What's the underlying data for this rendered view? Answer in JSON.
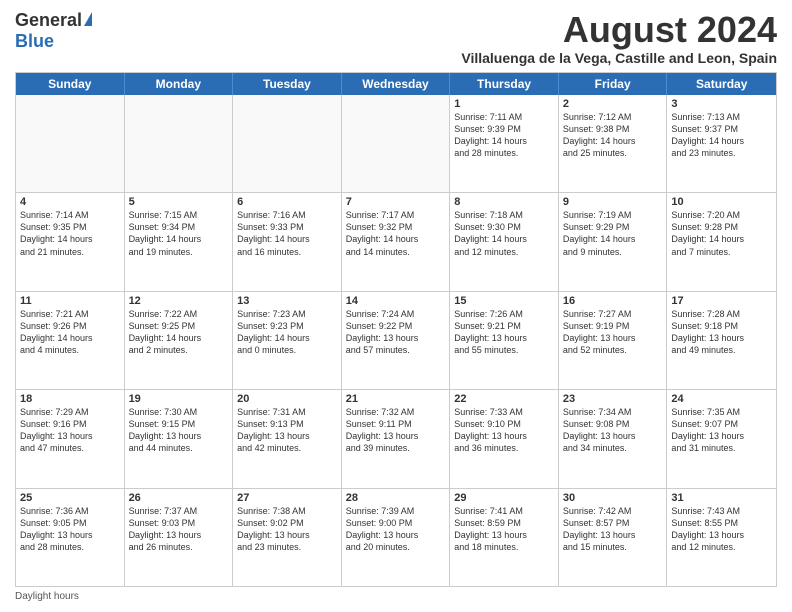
{
  "logo": {
    "general": "General",
    "blue": "Blue"
  },
  "header": {
    "month_title": "August 2024",
    "location": "Villaluenga de la Vega, Castille and Leon, Spain"
  },
  "weekdays": [
    "Sunday",
    "Monday",
    "Tuesday",
    "Wednesday",
    "Thursday",
    "Friday",
    "Saturday"
  ],
  "footer": {
    "label": "Daylight hours"
  },
  "rows": [
    [
      {
        "day": "",
        "info": "",
        "empty": true
      },
      {
        "day": "",
        "info": "",
        "empty": true
      },
      {
        "day": "",
        "info": "",
        "empty": true
      },
      {
        "day": "",
        "info": "",
        "empty": true
      },
      {
        "day": "1",
        "info": "Sunrise: 7:11 AM\nSunset: 9:39 PM\nDaylight: 14 hours\nand 28 minutes."
      },
      {
        "day": "2",
        "info": "Sunrise: 7:12 AM\nSunset: 9:38 PM\nDaylight: 14 hours\nand 25 minutes."
      },
      {
        "day": "3",
        "info": "Sunrise: 7:13 AM\nSunset: 9:37 PM\nDaylight: 14 hours\nand 23 minutes."
      }
    ],
    [
      {
        "day": "4",
        "info": "Sunrise: 7:14 AM\nSunset: 9:35 PM\nDaylight: 14 hours\nand 21 minutes."
      },
      {
        "day": "5",
        "info": "Sunrise: 7:15 AM\nSunset: 9:34 PM\nDaylight: 14 hours\nand 19 minutes."
      },
      {
        "day": "6",
        "info": "Sunrise: 7:16 AM\nSunset: 9:33 PM\nDaylight: 14 hours\nand 16 minutes."
      },
      {
        "day": "7",
        "info": "Sunrise: 7:17 AM\nSunset: 9:32 PM\nDaylight: 14 hours\nand 14 minutes."
      },
      {
        "day": "8",
        "info": "Sunrise: 7:18 AM\nSunset: 9:30 PM\nDaylight: 14 hours\nand 12 minutes."
      },
      {
        "day": "9",
        "info": "Sunrise: 7:19 AM\nSunset: 9:29 PM\nDaylight: 14 hours\nand 9 minutes."
      },
      {
        "day": "10",
        "info": "Sunrise: 7:20 AM\nSunset: 9:28 PM\nDaylight: 14 hours\nand 7 minutes."
      }
    ],
    [
      {
        "day": "11",
        "info": "Sunrise: 7:21 AM\nSunset: 9:26 PM\nDaylight: 14 hours\nand 4 minutes."
      },
      {
        "day": "12",
        "info": "Sunrise: 7:22 AM\nSunset: 9:25 PM\nDaylight: 14 hours\nand 2 minutes."
      },
      {
        "day": "13",
        "info": "Sunrise: 7:23 AM\nSunset: 9:23 PM\nDaylight: 14 hours\nand 0 minutes."
      },
      {
        "day": "14",
        "info": "Sunrise: 7:24 AM\nSunset: 9:22 PM\nDaylight: 13 hours\nand 57 minutes."
      },
      {
        "day": "15",
        "info": "Sunrise: 7:26 AM\nSunset: 9:21 PM\nDaylight: 13 hours\nand 55 minutes."
      },
      {
        "day": "16",
        "info": "Sunrise: 7:27 AM\nSunset: 9:19 PM\nDaylight: 13 hours\nand 52 minutes."
      },
      {
        "day": "17",
        "info": "Sunrise: 7:28 AM\nSunset: 9:18 PM\nDaylight: 13 hours\nand 49 minutes."
      }
    ],
    [
      {
        "day": "18",
        "info": "Sunrise: 7:29 AM\nSunset: 9:16 PM\nDaylight: 13 hours\nand 47 minutes."
      },
      {
        "day": "19",
        "info": "Sunrise: 7:30 AM\nSunset: 9:15 PM\nDaylight: 13 hours\nand 44 minutes."
      },
      {
        "day": "20",
        "info": "Sunrise: 7:31 AM\nSunset: 9:13 PM\nDaylight: 13 hours\nand 42 minutes."
      },
      {
        "day": "21",
        "info": "Sunrise: 7:32 AM\nSunset: 9:11 PM\nDaylight: 13 hours\nand 39 minutes."
      },
      {
        "day": "22",
        "info": "Sunrise: 7:33 AM\nSunset: 9:10 PM\nDaylight: 13 hours\nand 36 minutes."
      },
      {
        "day": "23",
        "info": "Sunrise: 7:34 AM\nSunset: 9:08 PM\nDaylight: 13 hours\nand 34 minutes."
      },
      {
        "day": "24",
        "info": "Sunrise: 7:35 AM\nSunset: 9:07 PM\nDaylight: 13 hours\nand 31 minutes."
      }
    ],
    [
      {
        "day": "25",
        "info": "Sunrise: 7:36 AM\nSunset: 9:05 PM\nDaylight: 13 hours\nand 28 minutes."
      },
      {
        "day": "26",
        "info": "Sunrise: 7:37 AM\nSunset: 9:03 PM\nDaylight: 13 hours\nand 26 minutes."
      },
      {
        "day": "27",
        "info": "Sunrise: 7:38 AM\nSunset: 9:02 PM\nDaylight: 13 hours\nand 23 minutes."
      },
      {
        "day": "28",
        "info": "Sunrise: 7:39 AM\nSunset: 9:00 PM\nDaylight: 13 hours\nand 20 minutes."
      },
      {
        "day": "29",
        "info": "Sunrise: 7:41 AM\nSunset: 8:59 PM\nDaylight: 13 hours\nand 18 minutes."
      },
      {
        "day": "30",
        "info": "Sunrise: 7:42 AM\nSunset: 8:57 PM\nDaylight: 13 hours\nand 15 minutes."
      },
      {
        "day": "31",
        "info": "Sunrise: 7:43 AM\nSunset: 8:55 PM\nDaylight: 13 hours\nand 12 minutes."
      }
    ]
  ]
}
